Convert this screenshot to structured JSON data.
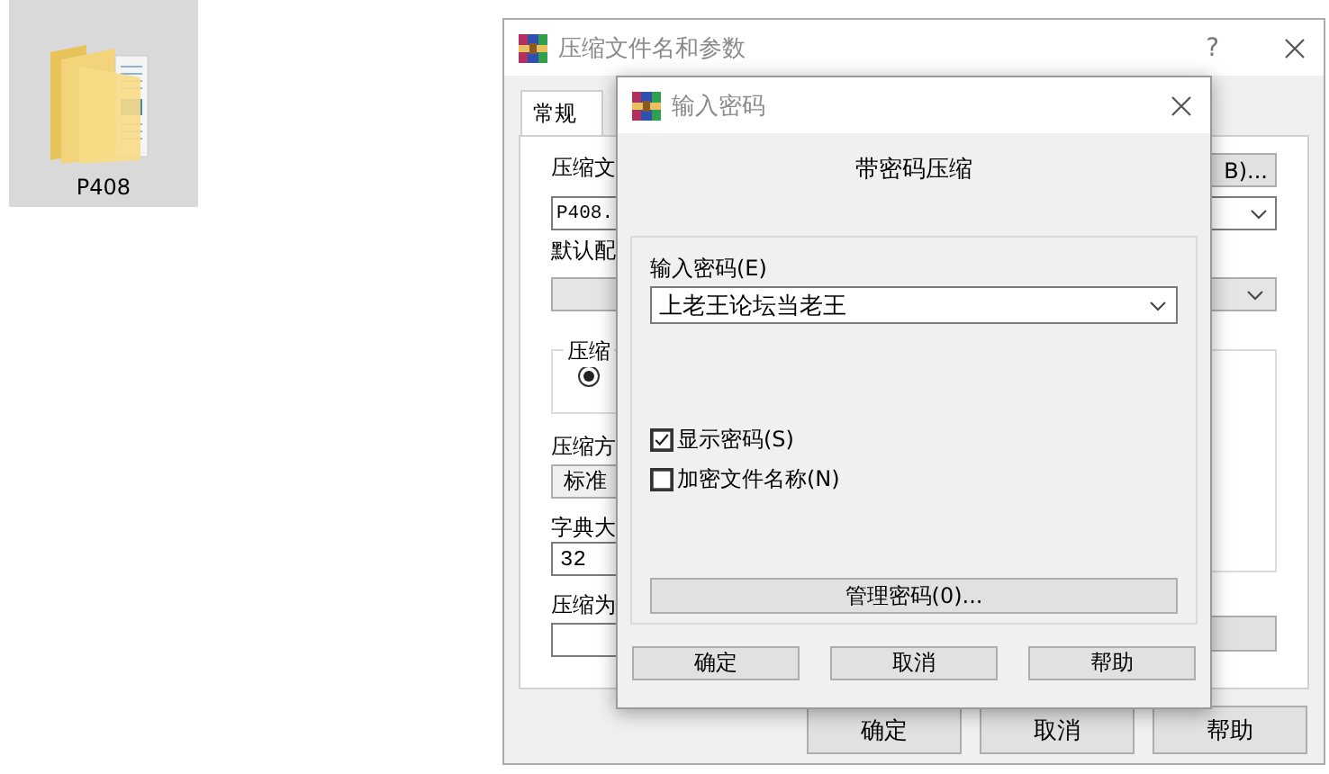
{
  "desktop": {
    "folder": {
      "label": "P408",
      "selected": true
    }
  },
  "main_dialog": {
    "title": "压缩文件名和参数",
    "help": "?",
    "tabs": [
      {
        "label": "常规",
        "selected": true
      }
    ],
    "archive_label": "压缩文",
    "browse_button": "B)...",
    "archive_value": "P408.",
    "profile_label": "默认配",
    "format_group": {
      "caption": "压缩",
      "radio_selected": true
    },
    "method_label": "压缩方",
    "method_value": "标准",
    "dict_label": "字典大",
    "dict_value": "32",
    "split_label": "压缩为",
    "buttons": [
      "确定",
      "取消",
      "帮助"
    ]
  },
  "password_dialog": {
    "title": "输入密码",
    "heading": "带密码压缩",
    "password_label": "输入密码(E)",
    "password_value": "上老王论坛当老王",
    "checkboxes": [
      {
        "label": "显示密码(S)",
        "checked": true
      },
      {
        "label": "加密文件名称(N)",
        "checked": false
      }
    ],
    "manage_button": "管理密码(0)...",
    "buttons": [
      "确定",
      "取消",
      "帮助"
    ]
  }
}
